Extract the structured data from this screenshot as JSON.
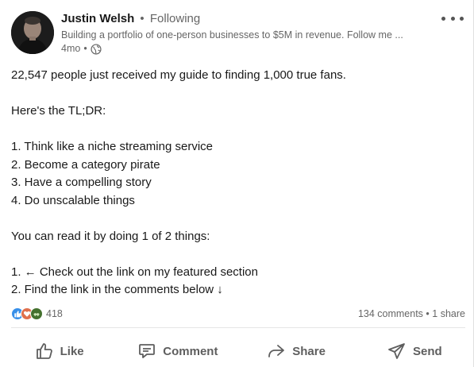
{
  "author": {
    "name": "Justin Welsh",
    "separator": "•",
    "follow_status": "Following",
    "headline": "Building a portfolio of one-person businesses to $5M in revenue. Follow me ...",
    "time_ago": "4mo",
    "meta_separator": "•",
    "visibility_icon": "globe-icon"
  },
  "post": {
    "lines": [
      "22,547 people just received my guide to finding 1,000 true fans.",
      "",
      "Here's the TL;DR:",
      "",
      "1. Think like a niche streaming service",
      "2. Become a category pirate",
      "3. Have a compelling story",
      "4. Do unscalable things",
      "",
      "You can read it by doing 1 of 2 things:",
      "",
      "1. ← Check out the link on my featured section",
      "2. Find the link in the comments below ↓"
    ]
  },
  "social": {
    "reaction_icons": [
      "like-reaction-icon",
      "love-reaction-icon",
      "support-reaction-icon"
    ],
    "reaction_count": "418",
    "comments": "134 comments",
    "separator": "•",
    "shares": "1 share"
  },
  "actions": {
    "like": "Like",
    "comment": "Comment",
    "share": "Share",
    "send": "Send"
  },
  "colors": {
    "like_blue": "#378fe9",
    "love_orange": "#df704d",
    "support_green": "#44712e",
    "muted_text": "#666666",
    "primary_text": "#191919"
  }
}
